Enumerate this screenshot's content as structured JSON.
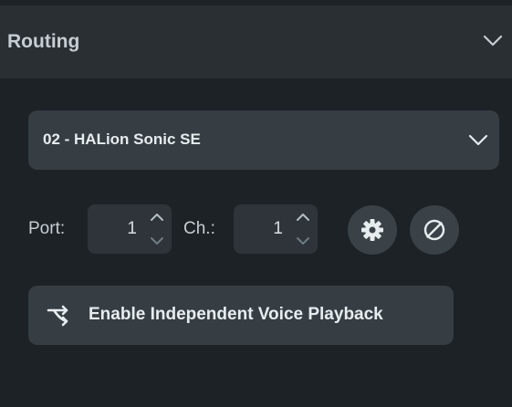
{
  "header": {
    "title": "Routing"
  },
  "device_select": {
    "value": "02 - HALion Sonic SE"
  },
  "port": {
    "label": "Port:",
    "value": "1"
  },
  "channel": {
    "label": "Ch.:",
    "value": "1"
  },
  "actions": {
    "settings_icon": "gear-icon",
    "edit_icon": "edit-circle-icon"
  },
  "voice_button": {
    "icon": "split-arrows-icon",
    "label": "Enable Independent Voice Playback"
  },
  "colors": {
    "background": "#1d2226",
    "header": "#2a2f33",
    "control": "#363d43",
    "text": "#e7ecef",
    "muted_text": "#c6ced4"
  }
}
